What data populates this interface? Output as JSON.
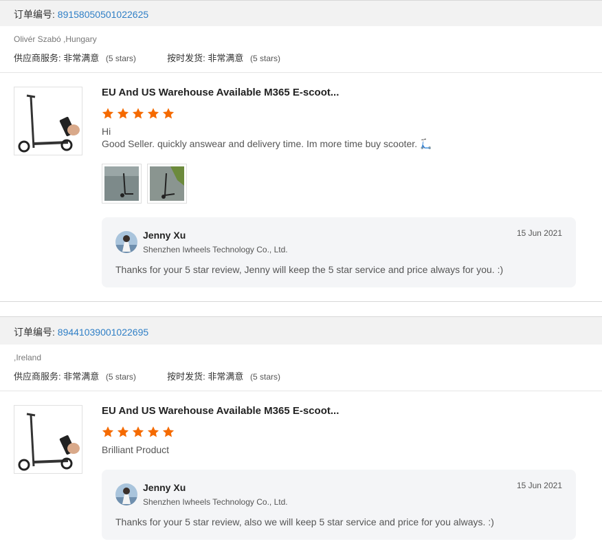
{
  "order_label": "订单编号:",
  "orders": [
    {
      "order_number": "89158050501022625",
      "buyer": "Olivér Szabó ,Hungary",
      "supplier_label": "供应商服务:",
      "supplier_value": "非常满意",
      "supplier_stars": "(5 stars)",
      "shipping_label": "按时发货:",
      "shipping_value": "非常满意",
      "shipping_stars": "(5 stars)",
      "product_title": "EU And US Warehouse Available M365 E-scoot...",
      "rating": 5,
      "review_line1": "Hi",
      "review_line2": "Good Seller. quickly answear and delivery time. Im more time buy scooter. 🛴",
      "reply": {
        "name": "Jenny Xu",
        "company": "Shenzhen Iwheels Technology Co., Ltd.",
        "date": "15 Jun 2021",
        "text": "Thanks for your 5 star review, Jenny will keep the 5 star service and price always for you. :)"
      }
    },
    {
      "order_number": "89441039001022695",
      "buyer": ",Ireland",
      "supplier_label": "供应商服务:",
      "supplier_value": "非常满意",
      "supplier_stars": "(5 stars)",
      "shipping_label": "按时发货:",
      "shipping_value": "非常满意",
      "shipping_stars": "(5 stars)",
      "product_title": "EU And US Warehouse Available M365 E-scoot...",
      "rating": 5,
      "review_line1": "Brilliant Product",
      "reply": {
        "name": "Jenny Xu",
        "company": "Shenzhen Iwheels Technology Co., Ltd.",
        "date": "15 Jun 2021",
        "text": "Thanks for your 5 star review, also we will keep 5 star service and price for you always. :)"
      }
    }
  ],
  "colors": {
    "star": "#f56a00",
    "link": "#2f7fc6",
    "reply_bg": "#f4f5f7"
  }
}
